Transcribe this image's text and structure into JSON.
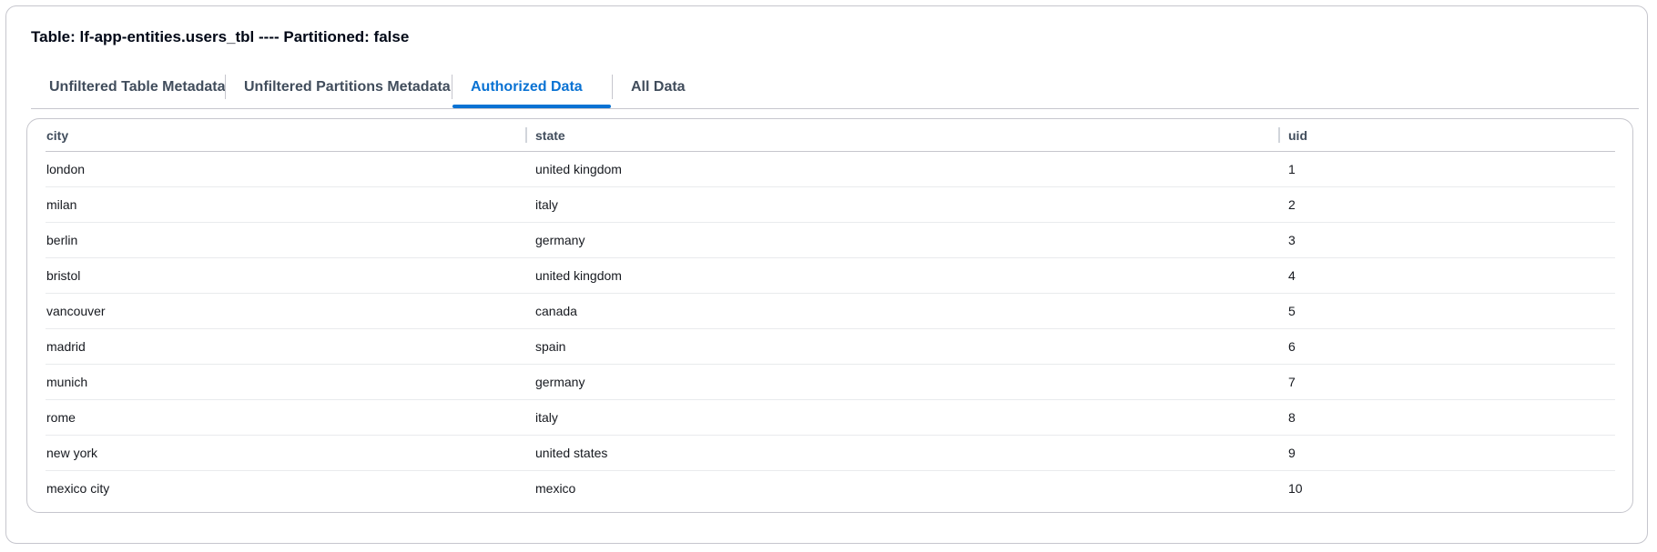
{
  "title": "Table: lf-app-entities.users_tbl ---- Partitioned: false",
  "tabs": [
    {
      "label": "Unfiltered Table Metadata",
      "active": false
    },
    {
      "label": "Unfiltered Partitions Metadata",
      "active": false
    },
    {
      "label": "Authorized Data",
      "active": true
    },
    {
      "label": "All Data",
      "active": false
    }
  ],
  "colors": {
    "accent": "#0972d3",
    "border": "#c6c6cd"
  },
  "table": {
    "columns": [
      "city",
      "state",
      "uid"
    ],
    "rows": [
      [
        "london",
        "united kingdom",
        "1"
      ],
      [
        "milan",
        "italy",
        "2"
      ],
      [
        "berlin",
        "germany",
        "3"
      ],
      [
        "bristol",
        "united kingdom",
        "4"
      ],
      [
        "vancouver",
        "canada",
        "5"
      ],
      [
        "madrid",
        "spain",
        "6"
      ],
      [
        "munich",
        "germany",
        "7"
      ],
      [
        "rome",
        "italy",
        "8"
      ],
      [
        "new york",
        "united states",
        "9"
      ],
      [
        "mexico city",
        "mexico",
        "10"
      ]
    ]
  }
}
